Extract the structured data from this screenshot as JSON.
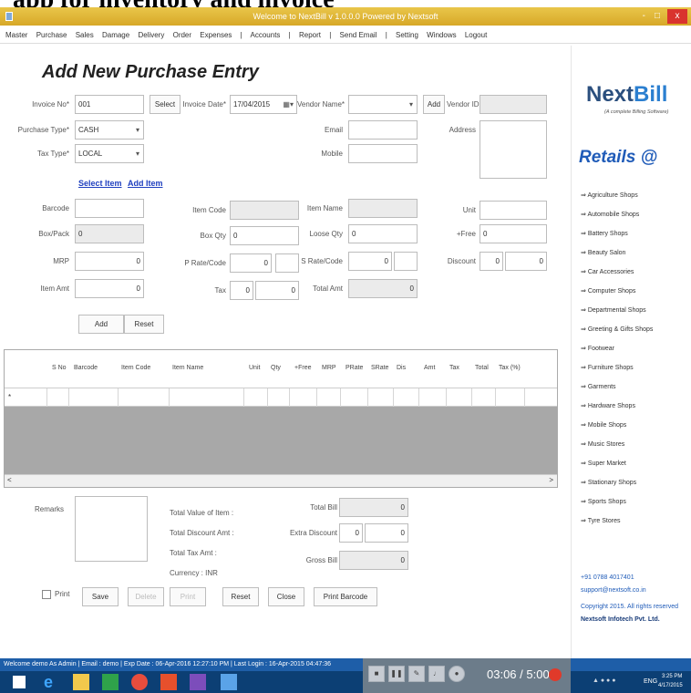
{
  "caption_text": "app for inventory and invoice",
  "window": {
    "title": "Welcome to NextBill v 1.0.0.0 Powered by Nextsoft",
    "min": "-",
    "max": "□",
    "close": "x"
  },
  "menu": [
    "Master",
    "Purchase",
    "Sales",
    "Damage",
    "Delivery",
    "Order",
    "Expenses",
    "|",
    "Accounts",
    "|",
    "Report",
    "|",
    "Send Email",
    "|",
    "Setting",
    "Windows",
    "Logout"
  ],
  "form": {
    "heading": "Add New Purchase Entry",
    "invoice_no_label": "Invoice No*",
    "invoice_no_value": "001",
    "select_button": "Select",
    "invoice_date_label": "Invoice Date*",
    "invoice_date_value": "17/04/2015",
    "vendor_name_label": "Vendor Name*",
    "vendor_add_button": "Add",
    "vendor_id_label": "Vendor ID",
    "purchase_type_label": "Purchase Type*",
    "purchase_type_value": "CASH",
    "email_label": "Email",
    "address_label": "Address",
    "tax_type_label": "Tax Type*",
    "tax_type_value": "LOCAL",
    "mobile_label": "Mobile",
    "select_item_link": "Select Item",
    "add_item_link": "Add Item",
    "barcode_label": "Barcode",
    "item_code_label": "Item Code",
    "item_name_label": "Item Name",
    "unit_label": "Unit",
    "box_pack_label": "Box/Pack",
    "box_pack_value": "0",
    "box_qty_label": "Box Qty",
    "box_qty_value": "0",
    "loose_qty_label": "Loose Qty",
    "loose_qty_value": "0",
    "free_label": "+Free",
    "free_value": "0",
    "mrp_label": "MRP",
    "mrp_value": "0",
    "prate_label": "P Rate/Code",
    "prate_value": "0",
    "srate_label": "S Rate/Code",
    "srate_value": "0",
    "discount_label": "Discount",
    "discount_value": "0",
    "discount_value2": "0",
    "item_amt_label": "Item Amt",
    "item_amt_value": "0",
    "tax_label": "Tax",
    "tax_value": "0",
    "tax_value2": "0",
    "total_amt_label": "Total Amt",
    "total_amt_value": "0",
    "add_button": "Add",
    "reset_button": "Reset"
  },
  "grid": {
    "columns": [
      "S No",
      "Barcode",
      "Item Code",
      "Item Name",
      "Unit",
      "Qty",
      "+Free",
      "MRP",
      "PRate",
      "SRate",
      "Dis",
      "Amt",
      "Tax",
      "Total",
      "Tax (%)"
    ],
    "row_marker": "*",
    "scroll_left": "<",
    "scroll_right": ">"
  },
  "summary": {
    "remarks_label": "Remarks",
    "total_value_label": "Total Value of Item :",
    "total_discount_label": "Total Discount Amt :",
    "total_tax_label": "Total Tax Amt :",
    "currency_label": "Currency : INR",
    "total_bill_label": "Total Bill",
    "total_bill_value": "0",
    "extra_discount_label": "Extra Discount",
    "extra_discount_value": "0",
    "extra_discount_value2": "0",
    "gross_bill_label": "Gross Bill",
    "gross_bill_value": "0"
  },
  "actions": {
    "print_check_label": "Print",
    "save": "Save",
    "delete": "Delete",
    "print": "Print",
    "reset": "Reset",
    "close": "Close",
    "print_barcode": "Print Barcode"
  },
  "sidebar": {
    "logo_a": "Next",
    "logo_b": "Bill",
    "tagline": "(A complete Billing Software)",
    "retails": "Retails @",
    "shops": [
      "Agriculture Shops",
      "Automobile Shops",
      "Battery Shops",
      "Beauty Salon",
      "Car Accessories",
      "Computer Shops",
      "Departmental Shops",
      "Greeting & Gifts Shops",
      "Footwear",
      "Furniture Shops",
      "Garments",
      "Hardware Shops",
      "Mobile Shops",
      "Music Stores",
      "Super Market",
      "Stationary Shops",
      "Sports Shops",
      "Tyre Stores"
    ],
    "phone": "+91 0788 4017401",
    "email": "support@nextsoft.co.in",
    "copyright": "Copyright 2015. All rights reserved",
    "company": "Nextsoft Infotech Pvt. Ltd."
  },
  "statusbar": "Welcome  demo  As  Admin  |  Email : demo  |  Exp Date : 06-Apr-2016 12:27:10 PM  |  Last Login : 16-Apr-2015 04:47:36",
  "player": {
    "time": "03:06 / 5:00"
  },
  "tray": {
    "lang": "ENG",
    "clock": "3:25 PM",
    "date": "4/17/2015"
  }
}
